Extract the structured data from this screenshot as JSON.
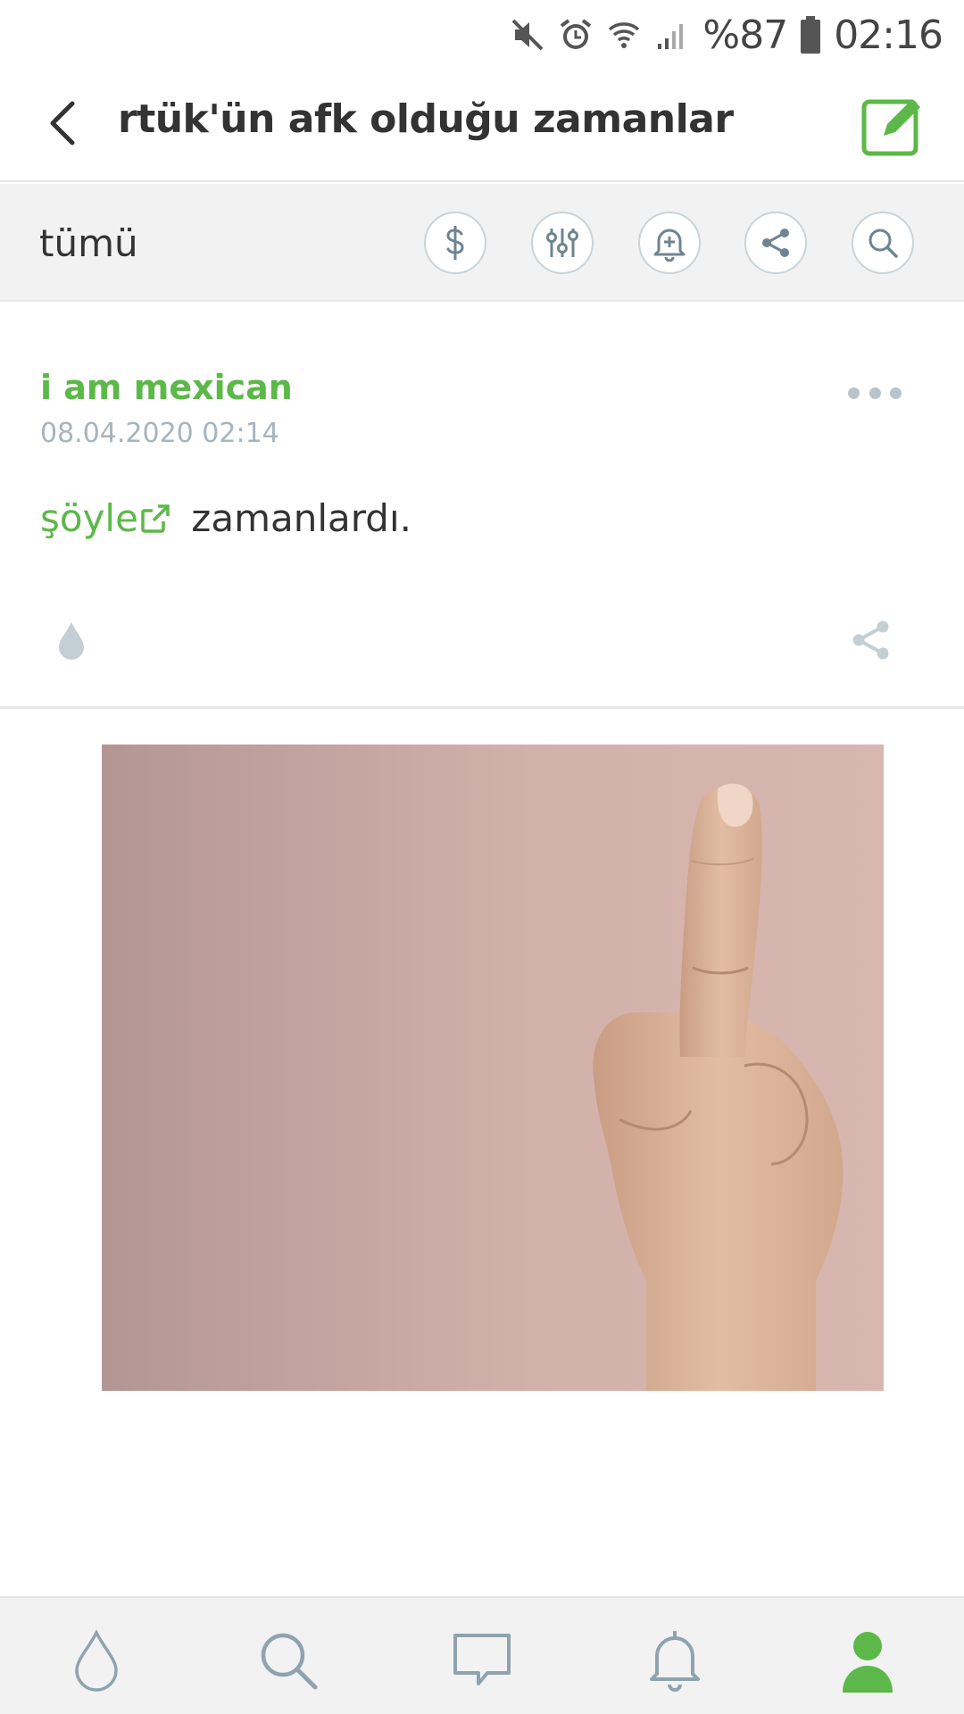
{
  "status_bar": {
    "battery": "%87",
    "time": "02:16",
    "icons": [
      "mute-icon",
      "alarm-icon",
      "wifi-icon",
      "signal-icon",
      "battery-icon"
    ]
  },
  "header": {
    "title": "rtük'ün afk olduğu zamanlar",
    "back_icon": "chevron-left-icon",
    "edit_icon": "pencil-icon",
    "accent": "#5cb848"
  },
  "toolbar": {
    "filter_label": "tümü",
    "buttons": [
      "dollar-icon",
      "sliders-icon",
      "bell-plus-icon",
      "share-icon",
      "search-icon"
    ]
  },
  "entry": {
    "author": "i am mexican",
    "date": "08.04.2020 02:14",
    "link_text": "şöyle",
    "text_after_link": " zamanlardı.",
    "actions": [
      "drop-icon",
      "share-icon",
      "more-icon"
    ]
  },
  "image": {
    "description_colors": [
      "#b39693",
      "#d8b7b1"
    ]
  },
  "bottom_nav": {
    "items": [
      "drop-icon",
      "search-icon",
      "chat-icon",
      "bell-icon",
      "user-icon"
    ],
    "active": "user-icon"
  }
}
